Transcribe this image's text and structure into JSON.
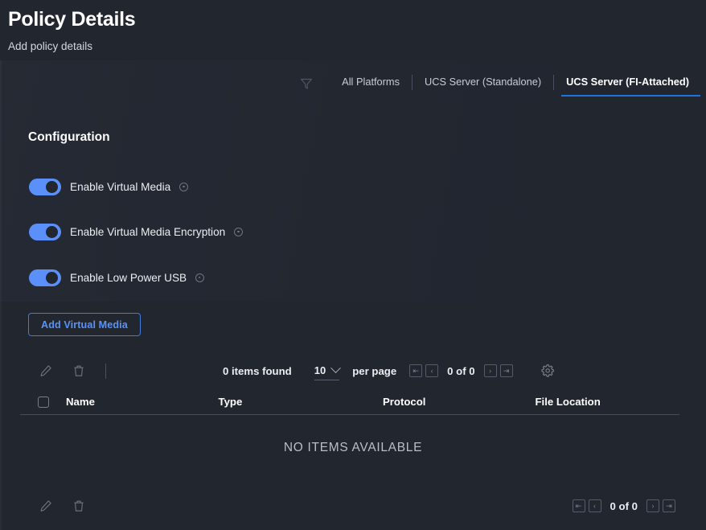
{
  "header": {
    "title": "Policy Details",
    "subtitle": "Add policy details"
  },
  "platform_bar": {
    "filter_icon": "filter-icon",
    "tabs": [
      {
        "label": "All Platforms",
        "active": false
      },
      {
        "label": "UCS Server (Standalone)",
        "active": false
      },
      {
        "label": "UCS Server (FI-Attached)",
        "active": true
      }
    ],
    "active_underline_color": "#1f72e0"
  },
  "configuration": {
    "title": "Configuration",
    "toggle_on_color": "#5b8ff9",
    "toggles": [
      {
        "label": "Enable Virtual Media",
        "state": "on",
        "info_icon": "info-icon"
      },
      {
        "label": "Enable Virtual Media Encryption",
        "state": "on",
        "info_icon": "info-icon"
      },
      {
        "label": "Enable Low Power USB",
        "state": "on",
        "info_icon": "info-icon"
      }
    ],
    "add_button": {
      "label": "Add Virtual Media",
      "text_color": "#5b93f5",
      "border_color": "#3d7ddd"
    }
  },
  "toolbar": {
    "edit_icon": "pencil-icon",
    "delete_icon": "trash-icon",
    "items_found": "0 items found",
    "per_page_value": "10",
    "per_page_label": "per page",
    "page_count": "0 of 0",
    "settings_icon": "gear-icon",
    "pager": {
      "first": "first-page",
      "prev": "previous-page",
      "next": "next-page",
      "last": "last-page"
    }
  },
  "table": {
    "columns": [
      "Name",
      "Type",
      "Protocol",
      "File Location"
    ],
    "rows": [],
    "empty_message": "NO ITEMS AVAILABLE",
    "select_all_checkbox": "unchecked"
  },
  "toolbar_bottom": {
    "edit_icon": "pencil-icon",
    "delete_icon": "trash-icon",
    "page_count": "0 of 0"
  }
}
